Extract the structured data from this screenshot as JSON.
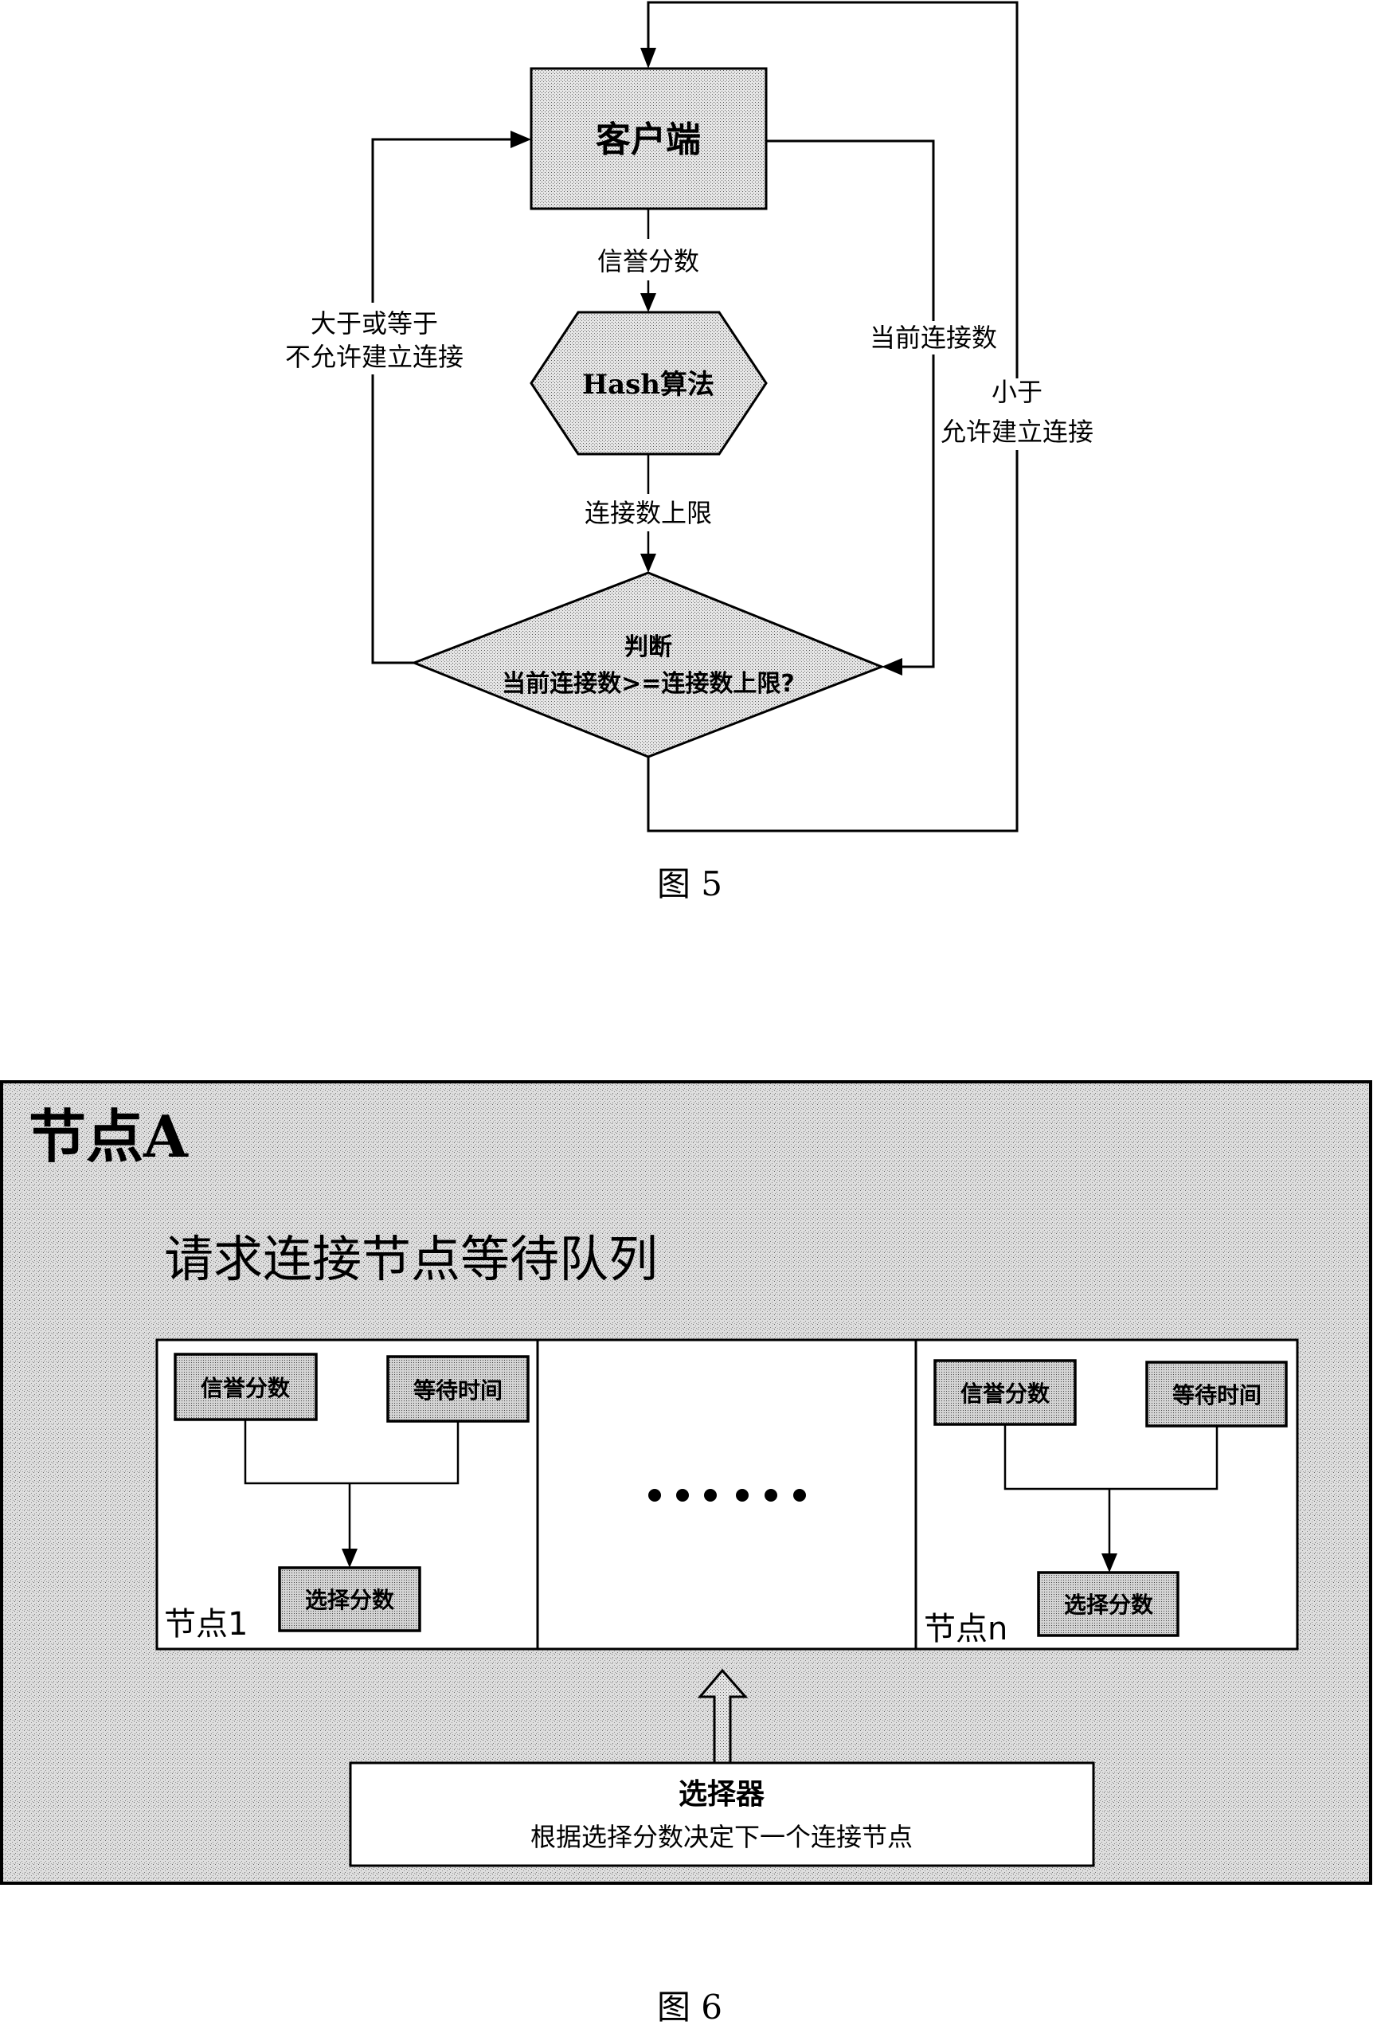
{
  "figure5": {
    "caption": "图 5",
    "client_label": "客户端",
    "edge_reputation": "信誉分数",
    "hash_label": "Hash算法",
    "edge_limit": "连接数上限",
    "decision_title": "判断",
    "decision_condition": "当前连接数>=连接数上限?",
    "left_branch_line1": "大于或等于",
    "left_branch_line2": "不允许建立连接",
    "right_edge_label": "当前连接数",
    "right_branch_line1": "小于",
    "right_branch_line2": "允许建立连接"
  },
  "figure6": {
    "caption": "图 6",
    "node_title": "节点A",
    "queue_title": "请求连接节点等待队列",
    "nodes": [
      {
        "label": "节点1",
        "reputation": "信誉分数",
        "wait_time": "等待时间",
        "select_score": "选择分数"
      },
      {
        "label": "节点n",
        "reputation": "信誉分数",
        "wait_time": "等待时间",
        "select_score": "选择分数"
      }
    ],
    "ellipsis": "● ● ● ● ● ●",
    "selector_title": "选择器",
    "selector_desc": "根据选择分数决定下一个连接节点"
  }
}
